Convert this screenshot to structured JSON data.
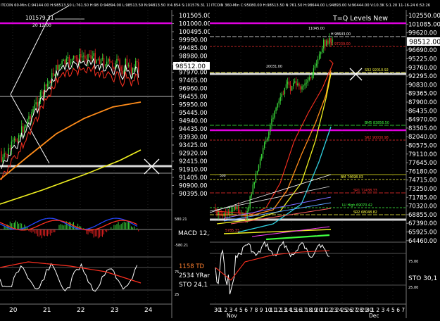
{
  "left": {
    "header": "ITCOIN 60-Min  C:94144.00  H:98513.50  L:761.50  H:98  O:94894.00  L:98513.50  N:94813.50  V:4.854  S:101579.31  11-20-24  52:26",
    "price_ticks": [
      "101505.00",
      "101000.00",
      "100495.00",
      "99990.00",
      "99485.00",
      "98980.00",
      "98475.00",
      "97970.00",
      "97465.00",
      "96960.00",
      "96455.00",
      "95950.00",
      "95445.00",
      "94940.00",
      "94435.00",
      "93930.00",
      "93425.00",
      "92920.00",
      "92415.00",
      "91910.00",
      "91405.00",
      "90900.00",
      "90395.00"
    ],
    "last_price": "98512.00",
    "annotations": {
      "high_value": "101579.31",
      "high_time": "20 12:00"
    },
    "macd_label": "MACD 12,2",
    "macd_ticks": [
      "580.21",
      "-580.21"
    ],
    "sto_label": "STO  24,1",
    "td_label": "1158 TD",
    "yrange_label": "2534 YRange",
    "sto_ticks": [
      "75",
      "25",
      "75.00",
      "25.00"
    ],
    "date_ticks": [
      "20",
      "21",
      "22",
      "23",
      "24"
    ]
  },
  "right": {
    "header": "ITCOIN 360-Min  C:95080.00  H:98513.50  N:761.50  H:98644.00  L:94893.00  N:90444.00  V:10.3K  S:1.20  11-16-24  6:52:26",
    "title": "T=Q Levels New",
    "price_ticks": [
      "102550.00",
      "101085.00",
      "99620.00",
      "98512.00",
      "96690.00",
      "95225.00",
      "93760.00",
      "92295.00",
      "90830.00",
      "89365.00",
      "87900.00",
      "86435.00",
      "84970.00",
      "83505.00",
      "82040.00",
      "80575.00",
      "79110.00",
      "77645.00",
      "76180.00",
      "74715.00",
      "73250.00",
      "71785.00",
      "70320.00",
      "68855.00",
      "67390.00",
      "65925.00",
      "64460.00"
    ],
    "levels": [
      {
        "label": "H 98643.00",
        "color": "#ffffff"
      },
      {
        "label": "R 97239.00",
        "color": "#ff3030"
      },
      {
        "label": "SR2 92010.92",
        "color": "#ffff40"
      },
      {
        "label": "SR2 90030.98",
        "color": "#ff3030"
      },
      {
        "label": "BM5 83856.50",
        "color": "#40ff40"
      },
      {
        "label": "BM 74698.03",
        "color": "#ffff40"
      },
      {
        "label": "SR1 72438.33",
        "color": "#ff3030"
      },
      {
        "label": "LU High 69070.42",
        "color": "#40ff40"
      },
      {
        "label": "SR2 68048.82",
        "color": "#ffff40"
      }
    ],
    "annotations": {
      "peak": "11045.00",
      "mid": "20031.00",
      "low": "5785.33",
      "level_500": "500"
    },
    "sto_label": "STO  30,1",
    "sto_ticks": [
      "75.00",
      "25.00"
    ],
    "date_ticks": [
      "30",
      "1",
      "2",
      "3",
      "4",
      "5",
      "6",
      "7",
      "8",
      "9",
      "10",
      "11",
      "12",
      "13",
      "14",
      "15",
      "16",
      "17",
      "18",
      "19",
      "20",
      "21",
      "22",
      "23",
      "24",
      "25",
      "26",
      "27",
      "28",
      "29",
      "30",
      "1",
      "2",
      "3",
      "4",
      "5",
      "6",
      "7",
      "8"
    ],
    "month_labels": [
      "Nov",
      "Dec"
    ]
  },
  "colors": {
    "magenta": "#e000e0",
    "white_line": "#d8d8d8",
    "red_ma": "#ff3020",
    "orange_ma": "#ff8c1a",
    "yellow_ma": "#f0f020",
    "cyan_ma": "#30d0e0",
    "grid": "#3a3a3a"
  }
}
